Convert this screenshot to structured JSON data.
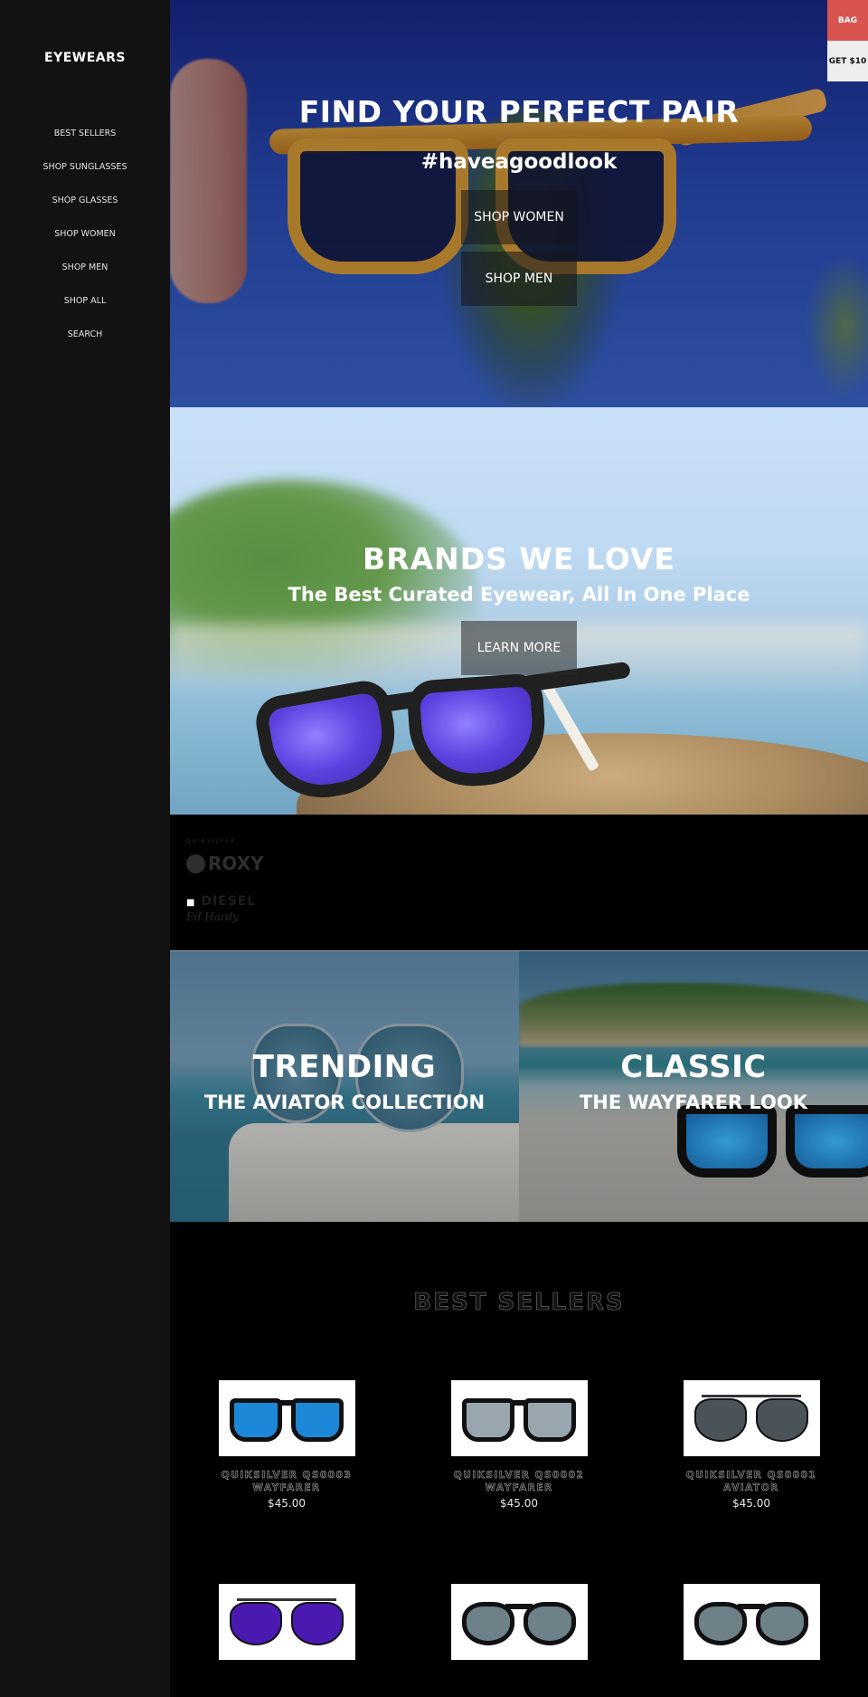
{
  "sidebar": {
    "logo": "EYEWEARS",
    "nav": [
      {
        "label": "BEST SELLERS"
      },
      {
        "label": "SHOP SUNGLASSES"
      },
      {
        "label": "SHOP GLASSES"
      },
      {
        "label": "SHOP WOMEN"
      },
      {
        "label": "SHOP MEN"
      },
      {
        "label": "SHOP ALL"
      },
      {
        "label": "SEARCH"
      }
    ]
  },
  "header_actions": {
    "bag_label": "BAG",
    "promo_label": "GET $10",
    "bag_color": "#d9534f"
  },
  "hero": {
    "title": "FIND YOUR PERFECT PAIR",
    "subtitle": "#haveagoodlook",
    "buttons": [
      {
        "label": "SHOP WOMEN"
      },
      {
        "label": "SHOP MEN"
      }
    ]
  },
  "brands_hero": {
    "title": "BRANDS WE LOVE",
    "subtitle": "The Best Curated Eyewear, All In One Place",
    "button": "LEARN MORE"
  },
  "brand_logos": [
    {
      "name": "QUIKSILVER",
      "icon": "quiksilver-logo"
    },
    {
      "name": "ROXY",
      "icon": "roxy-logo"
    },
    {
      "name": "DIESEL",
      "icon": "diesel-logo"
    },
    {
      "name": "Ed Hardy",
      "icon": "ed-hardy-logo"
    }
  ],
  "collections": [
    {
      "title": "TRENDING",
      "subtitle": "THE AVIATOR COLLECTION"
    },
    {
      "title": "CLASSIC",
      "subtitle": "THE WAYFARER LOOK"
    }
  ],
  "best_sellers": {
    "title": "BEST SELLERS",
    "products": [
      {
        "name": "QUIKSILVER QS0003 WAYFARER",
        "price": "$45.00",
        "style": "wayfarer",
        "lens_color": "#1e88d8"
      },
      {
        "name": "QUIKSILVER QS0002 WAYFARER",
        "price": "$45.00",
        "style": "wayfarer",
        "lens_color": "#9aa6ae"
      },
      {
        "name": "QUIKSILVER QS0001 AVIATOR",
        "price": "$45.00",
        "style": "aviator",
        "lens_color": "#4a5458"
      },
      {
        "name": "",
        "price": "",
        "style": "aviator",
        "lens_color": "#4a1ab0"
      },
      {
        "name": "",
        "price": "",
        "style": "round",
        "lens_color": "#6e8088"
      },
      {
        "name": "",
        "price": "",
        "style": "round",
        "lens_color": "#6e8088"
      }
    ]
  }
}
